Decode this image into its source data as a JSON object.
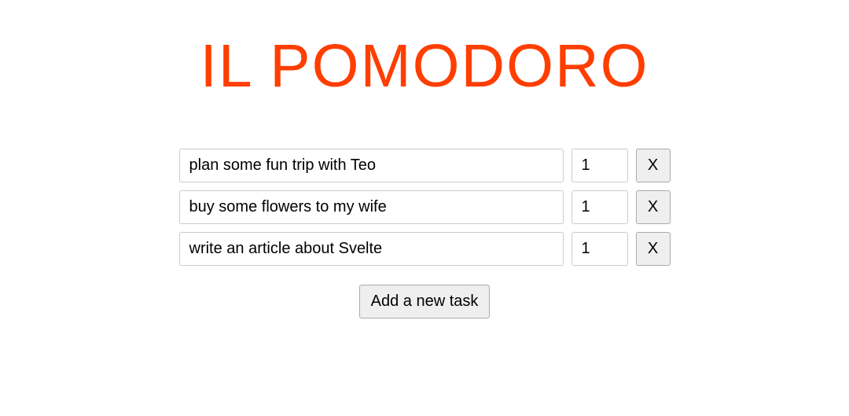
{
  "header": {
    "title": "IL POMODORO"
  },
  "tasks": [
    {
      "title": "plan some fun trip with Teo",
      "count": "1",
      "delete_label": "X"
    },
    {
      "title": "buy some flowers to my wife",
      "count": "1",
      "delete_label": "X"
    },
    {
      "title": "write an article about Svelte",
      "count": "1",
      "delete_label": "X"
    }
  ],
  "actions": {
    "add_task_label": "Add a new task"
  }
}
